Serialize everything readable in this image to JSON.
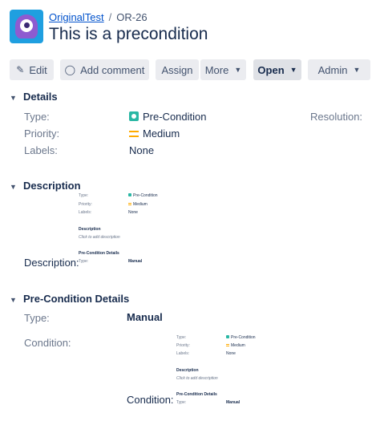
{
  "header": {
    "project_link": "OriginalTest",
    "separator": "/",
    "issue_key": "OR-26",
    "title": "This is a precondition"
  },
  "toolbar": {
    "edit": "Edit",
    "add_comment": "Add comment",
    "assign": "Assign",
    "more": "More",
    "status": "Open",
    "admin": "Admin"
  },
  "details": {
    "heading": "Details",
    "type_label": "Type:",
    "type_value": "Pre-Condition",
    "priority_label": "Priority:",
    "priority_value": "Medium",
    "labels_label": "Labels:",
    "labels_value": "None",
    "resolution_label": "Resolution:"
  },
  "description": {
    "heading": "Description",
    "field_label": "Description:"
  },
  "precondition_details": {
    "heading": "Pre-Condition Details",
    "type_label": "Type:",
    "type_value": "Manual",
    "condition_label": "Condition:"
  },
  "mini_panel": {
    "type_label": "Type:",
    "type_value": "Pre-Condition",
    "priority_label": "Priority:",
    "priority_value": "Medium",
    "labels_label": "Labels:",
    "labels_value": "None",
    "description_heading": "Description",
    "description_placeholder": "Click to add description",
    "details_heading": "Pre-Condition Details",
    "details_type_label": "Type:",
    "details_type_value": "Manual"
  },
  "colors": {
    "link": "#0052cc",
    "button_bg": "#ebecf0",
    "pre_condition_icon": "#2ab7a4",
    "priority_medium": "#ffab00",
    "avatar_bg": "#1f9fe0"
  }
}
